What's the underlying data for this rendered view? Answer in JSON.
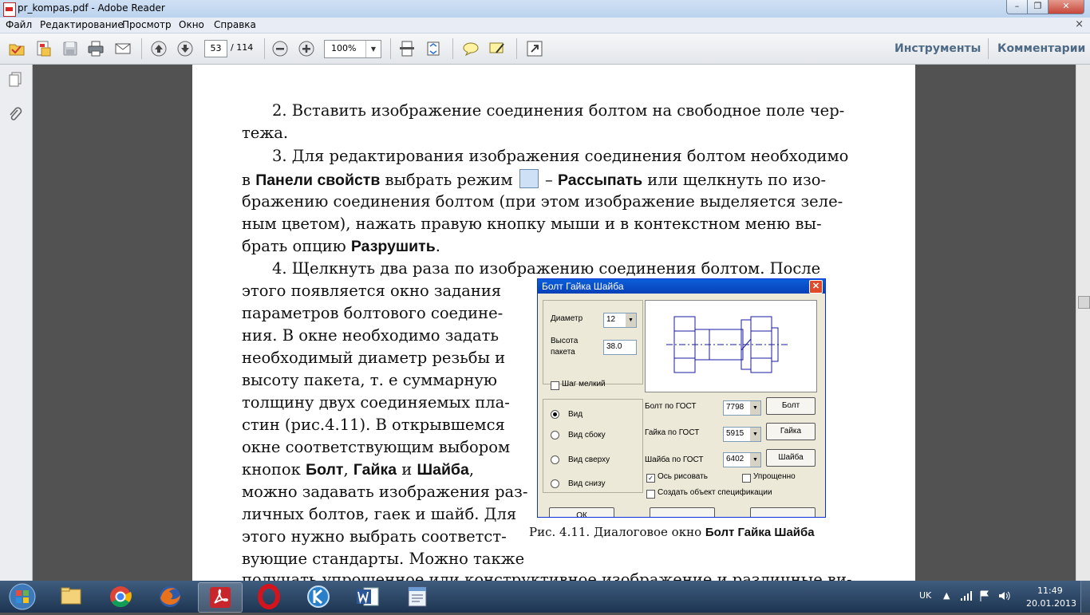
{
  "window": {
    "title": "pr_kompas.pdf - Adobe Reader",
    "min": "–",
    "max": "❐",
    "close": "✕"
  },
  "menu": {
    "items": [
      "Файл",
      "Редактирование",
      "Просмотр",
      "Окно",
      "Справка"
    ],
    "close": "×"
  },
  "toolbar": {
    "page_current": "53",
    "page_total": "/ 114",
    "zoom": "100%",
    "tools_label": "Инструменты",
    "comments_label": "Комментарии"
  },
  "document": {
    "item2_line1": "2.   Вставить изображение соединения болтом на свободное поле чер-",
    "item2_line2": "тежа.",
    "item3_line1": "3.   Для редактирования изображения соединения болтом необходимо",
    "item3_line2_a": "в ",
    "item3_line2_b": "Панели свойств",
    "item3_line2_c": " выбрать режим ",
    "item3_line2_d": " – ",
    "item3_line2_e": "Рассыпать",
    "item3_line2_f": " или  щелкнуть по изо-",
    "item3_line3": "бражению соединения болтом (при этом изображение выделяется зеле-",
    "item3_line4": "ным цветом), нажать правую кнопку мыши и в контекстном меню вы-",
    "item3_line5_a": "брать опцию ",
    "item3_line5_b": "Разрушить",
    "item3_line5_c": ".",
    "item4_line1": "4.   Щелкнуть два раза по изображению соединения болтом. После",
    "left_lines": [
      "этого появляется окно задания",
      "параметров болтового соедине-",
      "ния. В окне необходимо задать",
      "необходимый диаметр резьбы  и",
      "высоту пакета, т. е суммарную",
      "толщину двух соединяемых пла-",
      "стин (рис.4.11). В открывшемся",
      "окне соответствующим выбором"
    ],
    "buttons_line_a": "кнопок ",
    "buttons_line_b": "Болт",
    "buttons_line_c": ", ",
    "buttons_line_d": "Гайка",
    "buttons_line_e": " и ",
    "buttons_line_f": "Шайба",
    "buttons_line_g": ",",
    "left_lines2": [
      "можно задавать изображения раз-",
      "личных болтов, гаек и шайб. Для",
      "этого нужно выбрать соответст-",
      "вующие стандарты. Можно также"
    ],
    "last_line": "получать упрощенное или конструктивное изображение и различные ви-",
    "caption_a": "Рис. 4.11. Диалоговое окно ",
    "caption_b": "Болт Гайка Шайба"
  },
  "dialog": {
    "title": "Болт Гайка Шайба",
    "diameter_label": "Диаметр",
    "diameter_value": "12",
    "height_label_1": "Высота",
    "height_label_2": "пакета",
    "height_value": "38.0",
    "fine_pitch": "Шаг мелкий",
    "views": [
      "Вид",
      "Вид сбоку",
      "Вид сверху",
      "Вид снизу"
    ],
    "bolt_gost_label": "Болт по ГОСТ",
    "bolt_gost_value": "7798",
    "bolt_button": "Болт",
    "nut_gost_label": "Гайка по ГОСТ",
    "nut_gost_value": "5915",
    "nut_button": "Гайка",
    "washer_gost_label": "Шайба по ГОСТ",
    "washer_gost_value": "6402",
    "washer_button": "Шайба",
    "axis_label": "Ось рисовать",
    "simplified_label": "Упрощенно",
    "spec_label": "Создать объект спецификации",
    "ok_button": "ОК"
  },
  "taskbar": {
    "lang": "UK",
    "time": "11:49",
    "date": "20.01.2013"
  }
}
